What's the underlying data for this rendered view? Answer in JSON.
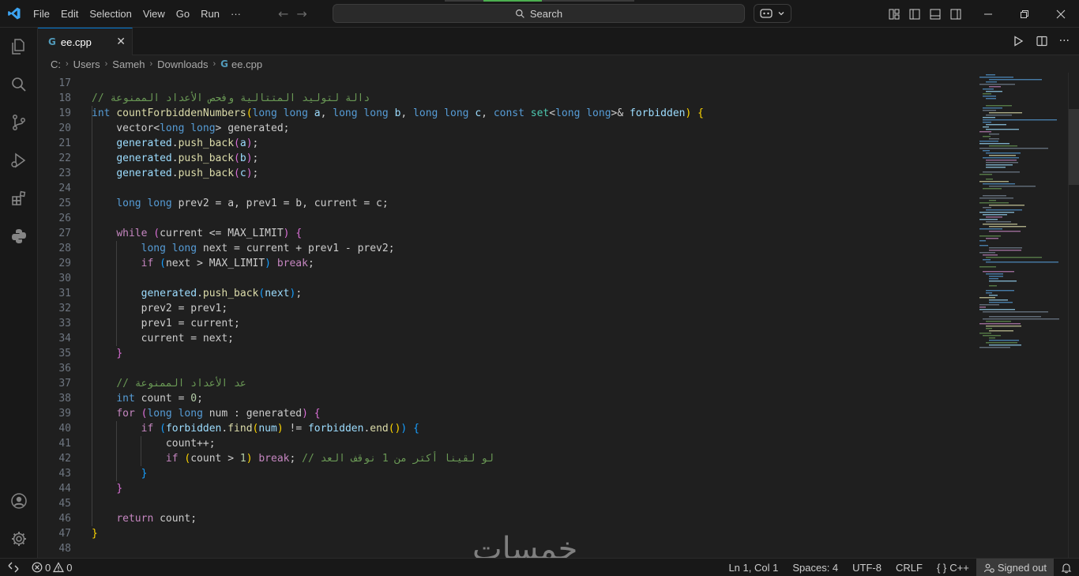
{
  "titlebar": {
    "menu": [
      "File",
      "Edit",
      "Selection",
      "View",
      "Go",
      "Run",
      "···"
    ],
    "search_label": "Search"
  },
  "tab": {
    "label": "ee.cpp",
    "icon_glyph": "G"
  },
  "breadcrumb": [
    "C:",
    "Users",
    "Sameh",
    "Downloads",
    "ee.cpp"
  ],
  "code": [
    {
      "n": "17",
      "parts": []
    },
    {
      "n": "18",
      "parts": [
        {
          "c": "t-com",
          "t": "// دالة لتوليد المتتالية وفحص الأعداد الممنوعة"
        }
      ]
    },
    {
      "n": "19",
      "parts": [
        {
          "c": "t-kw",
          "t": "int"
        },
        {
          "c": "",
          "t": " "
        },
        {
          "c": "t-fn",
          "t": "countForbiddenNumbers"
        },
        {
          "c": "t-br1",
          "t": "("
        },
        {
          "c": "t-kw",
          "t": "long long"
        },
        {
          "c": "",
          "t": " "
        },
        {
          "c": "t-var",
          "t": "a"
        },
        {
          "c": "",
          "t": ", "
        },
        {
          "c": "t-kw",
          "t": "long long"
        },
        {
          "c": "",
          "t": " "
        },
        {
          "c": "t-var",
          "t": "b"
        },
        {
          "c": "",
          "t": ", "
        },
        {
          "c": "t-kw",
          "t": "long long"
        },
        {
          "c": "",
          "t": " "
        },
        {
          "c": "t-var",
          "t": "c"
        },
        {
          "c": "",
          "t": ", "
        },
        {
          "c": "t-kw",
          "t": "const"
        },
        {
          "c": "",
          "t": " "
        },
        {
          "c": "t-type",
          "t": "set"
        },
        {
          "c": "",
          "t": "<"
        },
        {
          "c": "t-kw",
          "t": "long long"
        },
        {
          "c": "",
          "t": ">& "
        },
        {
          "c": "t-var",
          "t": "forbidden"
        },
        {
          "c": "t-br1",
          "t": ")"
        },
        {
          "c": "",
          "t": " "
        },
        {
          "c": "t-br1",
          "t": "{"
        }
      ]
    },
    {
      "n": "20",
      "parts": [
        {
          "c": "",
          "t": "    vector<"
        },
        {
          "c": "t-kw",
          "t": "long long"
        },
        {
          "c": "",
          "t": "> generated;"
        }
      ]
    },
    {
      "n": "21",
      "parts": [
        {
          "c": "",
          "t": "    "
        },
        {
          "c": "t-var",
          "t": "generated"
        },
        {
          "c": "",
          "t": "."
        },
        {
          "c": "t-fn",
          "t": "push_back"
        },
        {
          "c": "t-br2",
          "t": "("
        },
        {
          "c": "t-var",
          "t": "a"
        },
        {
          "c": "t-br2",
          "t": ")"
        },
        {
          "c": "",
          "t": ";"
        }
      ]
    },
    {
      "n": "22",
      "parts": [
        {
          "c": "",
          "t": "    "
        },
        {
          "c": "t-var",
          "t": "generated"
        },
        {
          "c": "",
          "t": "."
        },
        {
          "c": "t-fn",
          "t": "push_back"
        },
        {
          "c": "t-br2",
          "t": "("
        },
        {
          "c": "t-var",
          "t": "b"
        },
        {
          "c": "t-br2",
          "t": ")"
        },
        {
          "c": "",
          "t": ";"
        }
      ]
    },
    {
      "n": "23",
      "parts": [
        {
          "c": "",
          "t": "    "
        },
        {
          "c": "t-var",
          "t": "generated"
        },
        {
          "c": "",
          "t": "."
        },
        {
          "c": "t-fn",
          "t": "push_back"
        },
        {
          "c": "t-br2",
          "t": "("
        },
        {
          "c": "t-var",
          "t": "c"
        },
        {
          "c": "t-br2",
          "t": ")"
        },
        {
          "c": "",
          "t": ";"
        }
      ]
    },
    {
      "n": "24",
      "parts": []
    },
    {
      "n": "25",
      "parts": [
        {
          "c": "",
          "t": "    "
        },
        {
          "c": "t-kw",
          "t": "long long"
        },
        {
          "c": "",
          "t": " prev2 = a, prev1 = b, current = c;"
        }
      ]
    },
    {
      "n": "26",
      "parts": []
    },
    {
      "n": "27",
      "parts": [
        {
          "c": "",
          "t": "    "
        },
        {
          "c": "t-ctl",
          "t": "while"
        },
        {
          "c": "",
          "t": " "
        },
        {
          "c": "t-br2",
          "t": "("
        },
        {
          "c": "",
          "t": "current <= MAX_LIMIT"
        },
        {
          "c": "t-br2",
          "t": ")"
        },
        {
          "c": "",
          "t": " "
        },
        {
          "c": "t-br2",
          "t": "{"
        }
      ]
    },
    {
      "n": "28",
      "parts": [
        {
          "c": "",
          "t": "        "
        },
        {
          "c": "t-kw",
          "t": "long long"
        },
        {
          "c": "",
          "t": " next = current + prev1 - prev2;"
        }
      ]
    },
    {
      "n": "29",
      "parts": [
        {
          "c": "",
          "t": "        "
        },
        {
          "c": "t-ctl",
          "t": "if"
        },
        {
          "c": "",
          "t": " "
        },
        {
          "c": "t-br3",
          "t": "("
        },
        {
          "c": "",
          "t": "next > MAX_LIMIT"
        },
        {
          "c": "t-br3",
          "t": ")"
        },
        {
          "c": "",
          "t": " "
        },
        {
          "c": "t-ctl",
          "t": "break"
        },
        {
          "c": "",
          "t": ";"
        }
      ]
    },
    {
      "n": "30",
      "parts": []
    },
    {
      "n": "31",
      "parts": [
        {
          "c": "",
          "t": "        "
        },
        {
          "c": "t-var",
          "t": "generated"
        },
        {
          "c": "",
          "t": "."
        },
        {
          "c": "t-fn",
          "t": "push_back"
        },
        {
          "c": "t-br3",
          "t": "("
        },
        {
          "c": "t-var",
          "t": "next"
        },
        {
          "c": "t-br3",
          "t": ")"
        },
        {
          "c": "",
          "t": ";"
        }
      ]
    },
    {
      "n": "32",
      "parts": [
        {
          "c": "",
          "t": "        prev2 = prev1;"
        }
      ]
    },
    {
      "n": "33",
      "parts": [
        {
          "c": "",
          "t": "        prev1 = current;"
        }
      ]
    },
    {
      "n": "34",
      "parts": [
        {
          "c": "",
          "t": "        current = next;"
        }
      ]
    },
    {
      "n": "35",
      "parts": [
        {
          "c": "",
          "t": "    "
        },
        {
          "c": "t-br2",
          "t": "}"
        }
      ]
    },
    {
      "n": "36",
      "parts": []
    },
    {
      "n": "37",
      "parts": [
        {
          "c": "",
          "t": "    "
        },
        {
          "c": "t-com",
          "t": "// عد الأعداد الممنوعة"
        }
      ]
    },
    {
      "n": "38",
      "parts": [
        {
          "c": "",
          "t": "    "
        },
        {
          "c": "t-kw",
          "t": "int"
        },
        {
          "c": "",
          "t": " count = "
        },
        {
          "c": "t-num",
          "t": "0"
        },
        {
          "c": "",
          "t": ";"
        }
      ]
    },
    {
      "n": "39",
      "parts": [
        {
          "c": "",
          "t": "    "
        },
        {
          "c": "t-ctl",
          "t": "for"
        },
        {
          "c": "",
          "t": " "
        },
        {
          "c": "t-br2",
          "t": "("
        },
        {
          "c": "t-kw",
          "t": "long long"
        },
        {
          "c": "",
          "t": " num : generated"
        },
        {
          "c": "t-br2",
          "t": ")"
        },
        {
          "c": "",
          "t": " "
        },
        {
          "c": "t-br2",
          "t": "{"
        }
      ]
    },
    {
      "n": "40",
      "parts": [
        {
          "c": "",
          "t": "        "
        },
        {
          "c": "t-ctl",
          "t": "if"
        },
        {
          "c": "",
          "t": " "
        },
        {
          "c": "t-br3",
          "t": "("
        },
        {
          "c": "t-var",
          "t": "forbidden"
        },
        {
          "c": "",
          "t": "."
        },
        {
          "c": "t-fn",
          "t": "find"
        },
        {
          "c": "t-br1",
          "t": "("
        },
        {
          "c": "t-var",
          "t": "num"
        },
        {
          "c": "t-br1",
          "t": ")"
        },
        {
          "c": "",
          "t": " != "
        },
        {
          "c": "t-var",
          "t": "forbidden"
        },
        {
          "c": "",
          "t": "."
        },
        {
          "c": "t-fn",
          "t": "end"
        },
        {
          "c": "t-br1",
          "t": "()"
        },
        {
          "c": "t-br3",
          "t": ")"
        },
        {
          "c": "",
          "t": " "
        },
        {
          "c": "t-br3",
          "t": "{"
        }
      ]
    },
    {
      "n": "41",
      "parts": [
        {
          "c": "",
          "t": "            count++;"
        }
      ]
    },
    {
      "n": "42",
      "parts": [
        {
          "c": "",
          "t": "            "
        },
        {
          "c": "t-ctl",
          "t": "if"
        },
        {
          "c": "",
          "t": " "
        },
        {
          "c": "t-br1",
          "t": "("
        },
        {
          "c": "",
          "t": "count > "
        },
        {
          "c": "t-num",
          "t": "1"
        },
        {
          "c": "t-br1",
          "t": ")"
        },
        {
          "c": "",
          "t": " "
        },
        {
          "c": "t-ctl",
          "t": "break"
        },
        {
          "c": "",
          "t": "; "
        },
        {
          "c": "t-com",
          "t": "// لو لقينا أكتر من 1 نوقف العد"
        }
      ]
    },
    {
      "n": "43",
      "parts": [
        {
          "c": "",
          "t": "        "
        },
        {
          "c": "t-br3",
          "t": "}"
        }
      ]
    },
    {
      "n": "44",
      "parts": [
        {
          "c": "",
          "t": "    "
        },
        {
          "c": "t-br2",
          "t": "}"
        }
      ]
    },
    {
      "n": "45",
      "parts": []
    },
    {
      "n": "46",
      "parts": [
        {
          "c": "",
          "t": "    "
        },
        {
          "c": "t-ctl",
          "t": "return"
        },
        {
          "c": "",
          "t": " count;"
        }
      ]
    },
    {
      "n": "47",
      "parts": [
        {
          "c": "t-br1",
          "t": "}"
        }
      ]
    },
    {
      "n": "48",
      "parts": []
    }
  ],
  "watermark": "خمسات",
  "statusbar": {
    "errors": "0",
    "warnings": "0",
    "position": "Ln 1, Col 1",
    "spaces": "Spaces: 4",
    "encoding": "UTF-8",
    "eol": "CRLF",
    "language_braces": "{ }",
    "language": "C++",
    "account": "Signed out"
  },
  "colors": {
    "accent": "#0078d4",
    "background": "#1f1f1f",
    "chrome": "#181818"
  }
}
